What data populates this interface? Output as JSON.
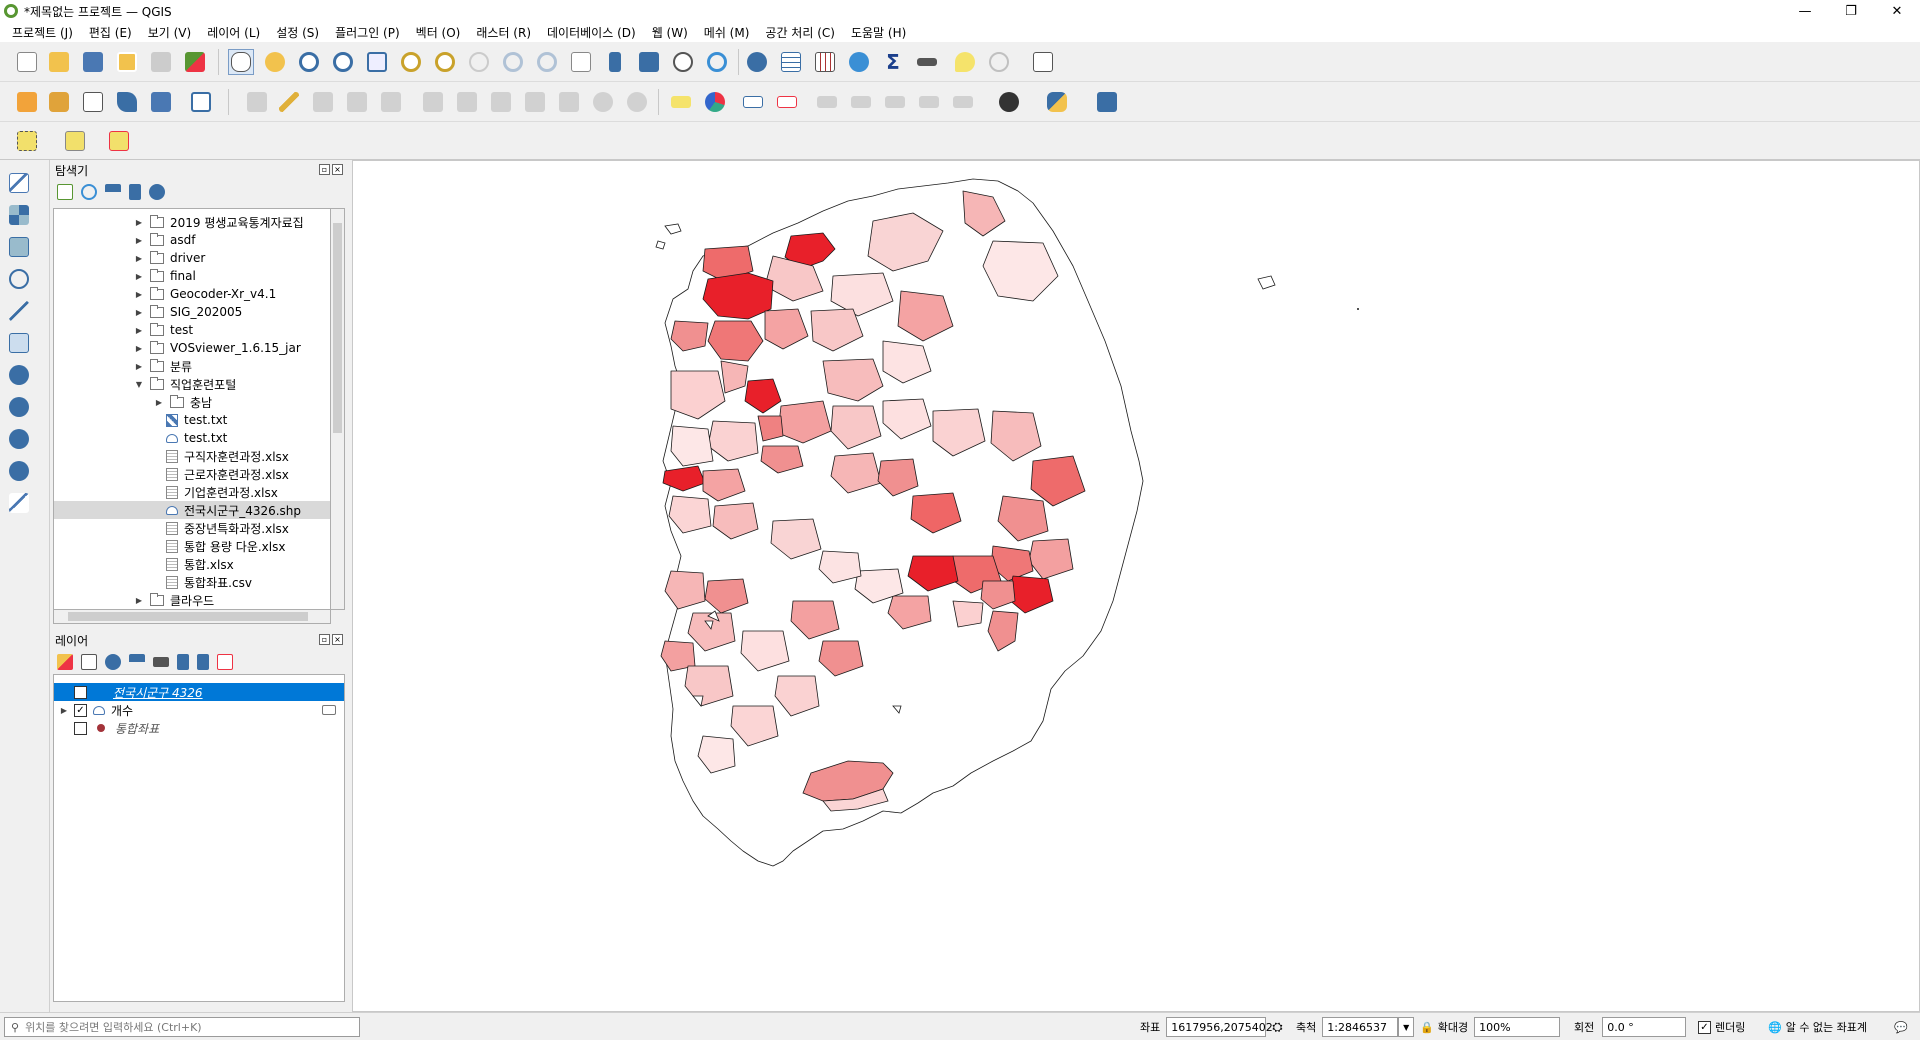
{
  "window": {
    "title": "*제목없는 프로젝트 — QGIS",
    "minimize": "—",
    "restore": "❐",
    "close": "✕"
  },
  "menu": [
    "프로젝트 (J)",
    "편집 (E)",
    "보기 (V)",
    "레이어 (L)",
    "설정 (S)",
    "플러그인 (P)",
    "벡터 (O)",
    "래스터 (R)",
    "데이터베이스 (D)",
    "웹 (W)",
    "메쉬 (M)",
    "공간 처리 (C)",
    "도움말 (H)"
  ],
  "browser": {
    "title": "탐색기",
    "items": [
      {
        "label": "2019 평생교육통계자료집",
        "type": "folder",
        "level": 0,
        "expander": "▶"
      },
      {
        "label": "asdf",
        "type": "folder",
        "level": 0,
        "expander": "▶"
      },
      {
        "label": "driver",
        "type": "folder",
        "level": 0,
        "expander": "▶"
      },
      {
        "label": "final",
        "type": "folder",
        "level": 0,
        "expander": "▶"
      },
      {
        "label": "Geocoder-Xr_v4.1",
        "type": "folder",
        "level": 0,
        "expander": "▶"
      },
      {
        "label": "SIG_202005",
        "type": "folder",
        "level": 0,
        "expander": "▶"
      },
      {
        "label": "test",
        "type": "folder",
        "level": 0,
        "expander": "▶"
      },
      {
        "label": "VOSviewer_1.6.15_jar",
        "type": "folder",
        "level": 0,
        "expander": "▶"
      },
      {
        "label": "분류",
        "type": "folder",
        "level": 0,
        "expander": "▶"
      },
      {
        "label": "직업훈련포털",
        "type": "folder",
        "level": 0,
        "expander": "▼"
      },
      {
        "label": "충남",
        "type": "folder",
        "level": 1,
        "expander": "▶"
      },
      {
        "label": "test.txt",
        "type": "pts",
        "level": 1,
        "expander": ""
      },
      {
        "label": "test.txt",
        "type": "shp",
        "level": 1,
        "expander": ""
      },
      {
        "label": "구직자훈련과정.xlsx",
        "type": "file",
        "level": 1,
        "expander": ""
      },
      {
        "label": "근로자훈련과정.xlsx",
        "type": "file",
        "level": 1,
        "expander": ""
      },
      {
        "label": "기업훈련과정.xlsx",
        "type": "file",
        "level": 1,
        "expander": ""
      },
      {
        "label": "전국시군구_4326.shp",
        "type": "shp",
        "level": 1,
        "expander": "",
        "selected": true
      },
      {
        "label": "중장년특화과정.xlsx",
        "type": "file",
        "level": 1,
        "expander": ""
      },
      {
        "label": "통합 용량 다운.xlsx",
        "type": "file",
        "level": 1,
        "expander": ""
      },
      {
        "label": "통합.xlsx",
        "type": "file",
        "level": 1,
        "expander": ""
      },
      {
        "label": "통합좌표.csv",
        "type": "file",
        "level": 1,
        "expander": ""
      },
      {
        "label": "클라우드",
        "type": "folder",
        "level": 0,
        "expander": "▶"
      }
    ]
  },
  "layers": {
    "title": "레이어",
    "items": [
      {
        "label": "전국시군구 4326",
        "checked": false,
        "active": true,
        "expander": ""
      },
      {
        "label": "개수",
        "checked": true,
        "active": false,
        "expander": "▶"
      },
      {
        "label": "통합좌표",
        "checked": false,
        "active": false,
        "expander": ""
      }
    ]
  },
  "status": {
    "search_placeholder": "위치를 찾으려면 입력하세요 (Ctrl+K)",
    "coord_label": "좌표",
    "coord_value": "1617956,2075402",
    "scale_label": "축척",
    "scale_value": "1:2846537",
    "magnifier_label": "확대경",
    "magnifier_value": "100%",
    "rotation_label": "회전",
    "rotation_value": "0.0 °",
    "render_label": "렌더링",
    "crs_label": "알 수 없는 좌표계"
  },
  "colors": {
    "accent": "#0078d7",
    "choropleth_high": "#e8202a",
    "choropleth_low": "#fbe3e3",
    "qgis_green": "#589632"
  }
}
